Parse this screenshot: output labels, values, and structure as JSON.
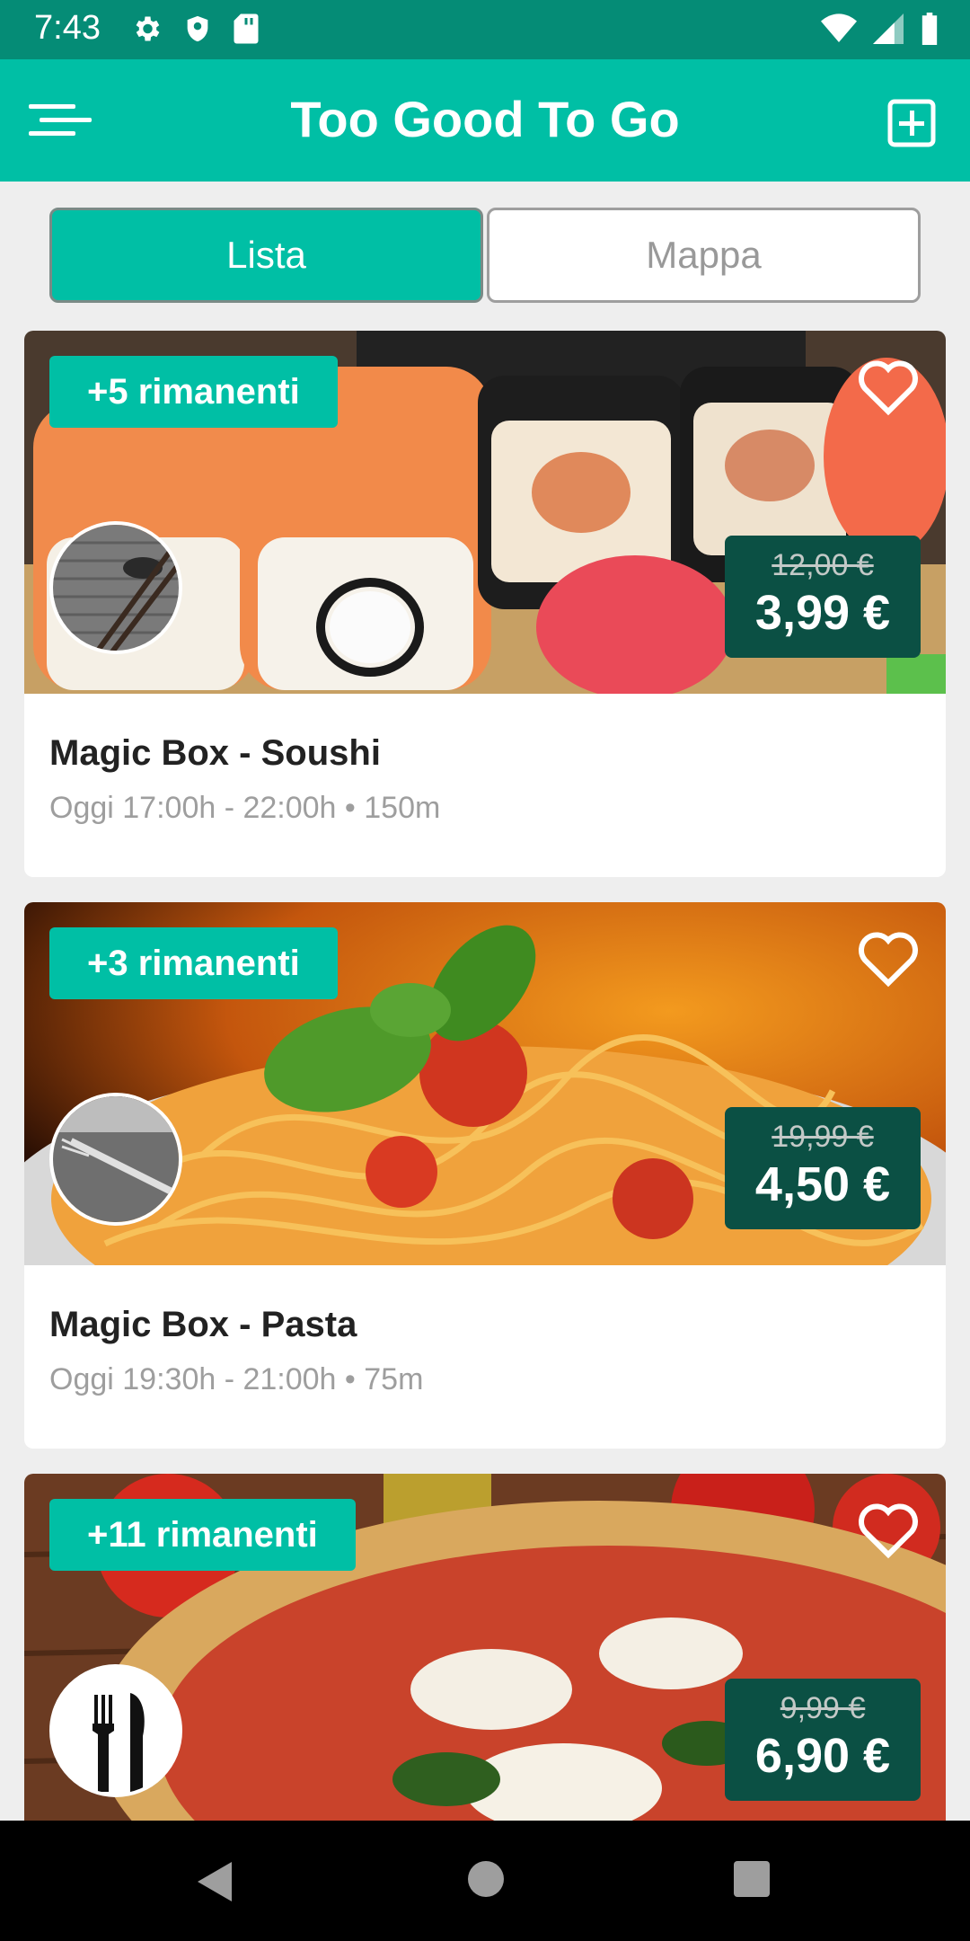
{
  "status_bar": {
    "time": "7:43",
    "left_icons": [
      "gear-icon",
      "shield-icon",
      "sd-card-icon"
    ],
    "right_icons": [
      "wifi-icon",
      "signal-icon",
      "battery-icon"
    ]
  },
  "app_bar": {
    "title": "Too Good To Go",
    "menu_icon": "menu-icon",
    "add_icon": "add-box-icon"
  },
  "tabs": {
    "list_label": "Lista",
    "map_label": "Mappa",
    "selected": "Lista"
  },
  "cards": [
    {
      "badge": "+5 rimanenti",
      "old_price": "12,00 €",
      "new_price": "3,99 €",
      "name": "Magic Box - Soushi",
      "meta": "Oggi 17:00h - 22:00h • 150m"
    },
    {
      "badge": "+3 rimanenti",
      "old_price": "19,99 €",
      "new_price": "4,50 €",
      "name": "Magic Box - Pasta",
      "meta": "Oggi 19:30h - 21:00h • 75m"
    },
    {
      "badge": "+11 rimanenti",
      "old_price": "9,99 €",
      "new_price": "6,90 €",
      "name": "",
      "meta": ""
    }
  ],
  "colors": {
    "status_bar": "#058c76",
    "accent": "#00bfa5",
    "price_box": "#0b5044",
    "background": "#eeeeee"
  },
  "nav_bar": {
    "icons": [
      "back-icon",
      "home-icon",
      "recents-icon"
    ]
  }
}
